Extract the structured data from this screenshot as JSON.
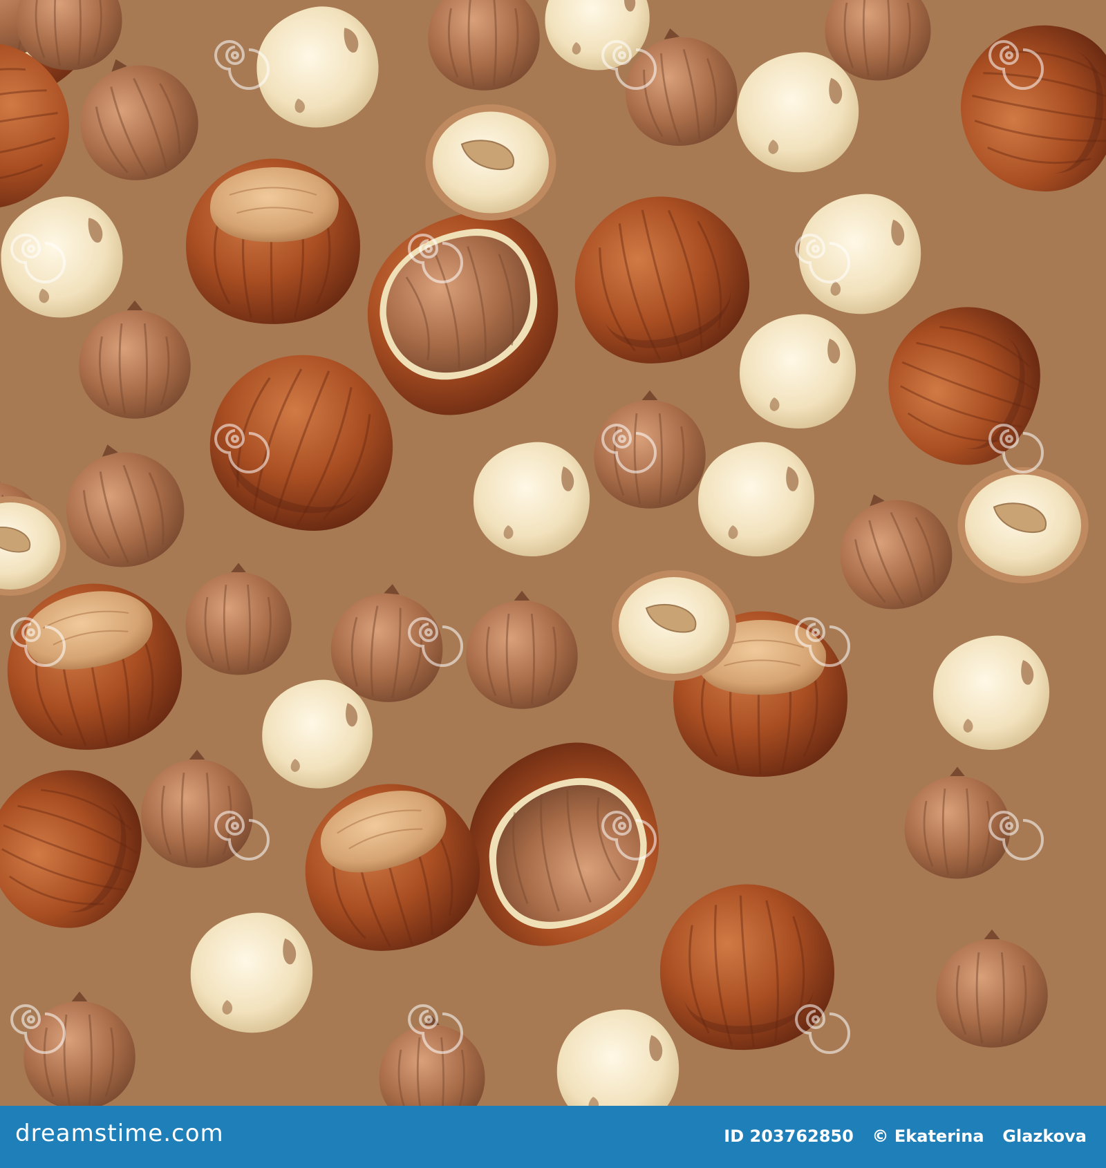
{
  "image": {
    "subject": "hazelnut-pattern",
    "background_color": "#a77a54"
  },
  "footer": {
    "brand": "dreamstime.com",
    "id_label": "ID",
    "id_value": "203762850",
    "copyright_symbol": "©",
    "author_first": "Ekaterina",
    "author_last": "Glazkova",
    "bar_color": "#1f7fb8"
  },
  "watermark": {
    "text": "dreamstime"
  }
}
